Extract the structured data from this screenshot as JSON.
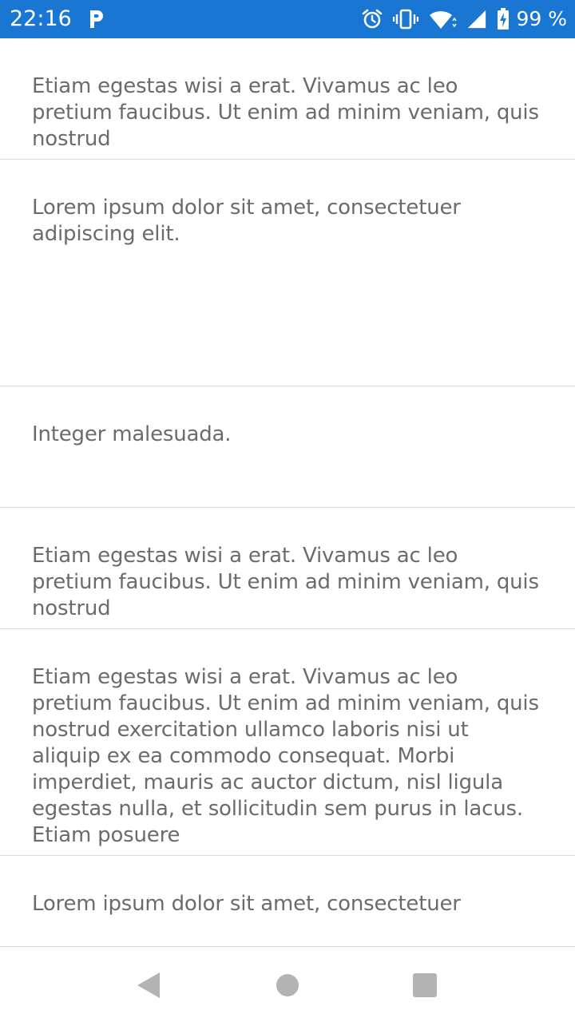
{
  "status_bar": {
    "time": "22:16",
    "battery_text": "99 %",
    "icons": [
      "parking-icon",
      "alarm-icon",
      "vibrate-icon",
      "wifi-icon",
      "signal-icon",
      "battery-charging-icon"
    ],
    "bg_color": "#1976d2"
  },
  "list": {
    "items": [
      {
        "text": "Etiam egestas wisi a erat. Vivamus ac leo pretium faucibus. Ut enim ad minim veniam, quis nostrud"
      },
      {
        "text": "Lorem ipsum dolor sit amet, consectetuer adipiscing elit."
      },
      {
        "text": "Integer malesuada."
      },
      {
        "text": "Etiam egestas wisi a erat. Vivamus ac leo pretium faucibus. Ut enim ad minim veniam, quis nostrud"
      },
      {
        "text": "Etiam egestas wisi a erat. Vivamus ac leo pretium faucibus. Ut enim ad minim veniam, quis nostrud exercitation ullamco laboris nisi ut aliquip ex ea commodo consequat. Morbi imperdiet, mauris ac auctor dictum, nisl ligula egestas nulla, et sollicitudin sem purus in lacus. Etiam posuere"
      },
      {
        "text": "Lorem ipsum dolor sit amet, consectetuer"
      }
    ],
    "text_color": "#6b6b6b",
    "divider_color": "#dcdcdc"
  },
  "nav_bar": {
    "buttons": [
      "back-icon",
      "home-icon",
      "recents-icon"
    ],
    "icon_color": "#b3b3b3"
  }
}
